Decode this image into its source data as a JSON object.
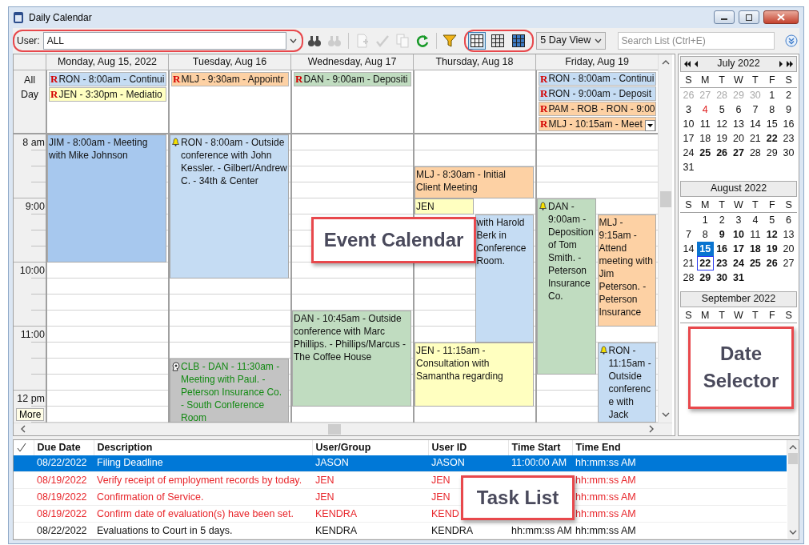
{
  "window": {
    "title": "Daily Calendar"
  },
  "toolbar": {
    "user_label": "User:",
    "user_value": "ALL",
    "user_highlighted": true,
    "tool_groups": [
      [
        {
          "kind": "find",
          "disabled": false
        },
        {
          "kind": "find_all",
          "disabled": true
        }
      ],
      [
        {
          "kind": "note",
          "disabled": true
        },
        {
          "kind": "check",
          "disabled": true
        },
        {
          "kind": "copy",
          "disabled": true
        },
        {
          "kind": "refresh",
          "disabled": false
        }
      ],
      [
        {
          "kind": "filter",
          "disabled": false
        }
      ]
    ],
    "views": [
      {
        "selected": true
      },
      {
        "selected": false
      },
      {
        "selected": false
      }
    ],
    "views_highlighted": true,
    "view_mode": "5 Day View",
    "search_placeholder": "Search List (Ctrl+E)"
  },
  "calendar": {
    "all_day_label": "All Day",
    "time_labels": [
      "8 am",
      "9:00",
      "10:00",
      "11:00",
      "12 pm"
    ],
    "more_label": "More",
    "callout": "Event Calendar",
    "days": [
      {
        "header": "Monday, Aug 15, 2022",
        "overflow": false,
        "all_day": [
          {
            "marker": "R",
            "text": "RON - 8:00am - Continui",
            "color": "#c5dcf3"
          },
          {
            "marker": "R",
            "text": "JEN - 3:30pm - Mediatio",
            "color": "#ffffc0"
          }
        ],
        "events": [
          {
            "text": "JIM - 8:00am - Meeting with Mike Johnson",
            "color": "#a7c8ee",
            "alarm": false,
            "shared": false
          }
        ]
      },
      {
        "header": "Tuesday, Aug 16",
        "overflow": false,
        "all_day": [
          {
            "marker": "R",
            "text": "MLJ - 9:30am - Appointr",
            "color": "#fdd1a4"
          }
        ],
        "events": [
          {
            "text": "RON - 8:00am - Outside conference with John Kessler. - Gilbert/Andrew C. - 34th & Center",
            "color": "#c5dcf3",
            "alarm": true,
            "shared": false
          },
          {
            "text": "CLB - DAN - 11:30am - Meeting with Paul. - Peterson Insurance Co. - South Conference Room",
            "color": "#c3c3c3",
            "alarm": false,
            "shared": true
          }
        ]
      },
      {
        "header": "Wednesday, Aug 17",
        "overflow": false,
        "all_day": [
          {
            "marker": "R",
            "text": "DAN - 9:00am - Depositi",
            "color": "#c0dcc0"
          }
        ],
        "events": [
          {
            "text": "DAN - 10:45am - Outside conference with Marc Phillips. - Phillips/Marcus - The Coffee House",
            "color": "#c0dcc0",
            "alarm": false,
            "shared": false
          }
        ]
      },
      {
        "header": "Thursday, Aug 18",
        "overflow": false,
        "events": [
          {
            "text": "MLJ - 8:30am - Initial Client Meeting",
            "color": "#fdd1a4",
            "alarm": false,
            "shared": false
          },
          {
            "text": "JEN",
            "color": "#ffffc0",
            "alarm": false,
            "shared": false
          },
          {
            "text": "with Harold Berk in Conference Room.",
            "color": "#c5dcf3",
            "alarm": false,
            "shared": false
          },
          {
            "text": "JEN - 11:15am - Consultation with Samantha regarding",
            "color": "#ffffc0",
            "alarm": false,
            "shared": false
          }
        ]
      },
      {
        "header": "Friday, Aug 19",
        "overflow": true,
        "all_day": [
          {
            "marker": "R",
            "text": "RON - 8:00am - Continui",
            "color": "#c5dcf3"
          },
          {
            "marker": "R",
            "text": "RON - 9:00am - Deposit",
            "color": "#c5dcf3"
          },
          {
            "marker": "R",
            "text": "PAM - ROB - RON - 9:00",
            "color": "#fdd1a4"
          },
          {
            "marker": "R",
            "text": "MLJ - 10:15am - Meet",
            "color": "#fdd1a4"
          }
        ],
        "events": [
          {
            "text": "DAN - 9:00am - Deposition of Tom Smith. - Peterson Insurance Co.",
            "color": "#c0dcc0",
            "alarm": true,
            "shared": false
          },
          {
            "text": "MLJ - 9:15am - Attend meeting with Jim Peterson. - Peterson Insurance",
            "color": "#fdd1a4",
            "alarm": false,
            "shared": false
          },
          {
            "text": "RON - 11:15am - Outside conference with Jack",
            "color": "#c5dcf3",
            "alarm": true,
            "shared": false
          }
        ]
      }
    ]
  },
  "date_selector": {
    "callout": "Date Selector",
    "months": [
      {
        "title": "July 2022",
        "navigation": true,
        "weekdays": [
          "S",
          "M",
          "T",
          "W",
          "T",
          "F",
          "S"
        ],
        "weeks": [
          [
            {
              "d": "26",
              "kind": "other",
              "selected": false,
              "today": false
            },
            {
              "d": "27",
              "kind": "other",
              "selected": false,
              "today": false
            },
            {
              "d": "28",
              "kind": "other",
              "selected": false,
              "today": false
            },
            {
              "d": "29",
              "kind": "other",
              "selected": false,
              "today": false
            },
            {
              "d": "30",
              "kind": "other",
              "selected": false,
              "today": false
            },
            {
              "d": "1",
              "kind": "plain",
              "selected": false,
              "today": false
            },
            {
              "d": "2",
              "kind": "plain",
              "selected": false,
              "today": false
            }
          ],
          [
            {
              "d": "3",
              "kind": "plain",
              "selected": false,
              "today": false
            },
            {
              "d": "4",
              "kind": "holiday",
              "selected": false,
              "today": false
            },
            {
              "d": "5",
              "kind": "plain",
              "selected": false,
              "today": false
            },
            {
              "d": "6",
              "kind": "plain",
              "selected": false,
              "today": false
            },
            {
              "d": "7",
              "kind": "plain",
              "selected": false,
              "today": false
            },
            {
              "d": "8",
              "kind": "plain",
              "selected": false,
              "today": false
            },
            {
              "d": "9",
              "kind": "plain",
              "selected": false,
              "today": false
            }
          ],
          [
            {
              "d": "10",
              "kind": "plain",
              "selected": false,
              "today": false
            },
            {
              "d": "11",
              "kind": "plain",
              "selected": false,
              "today": false
            },
            {
              "d": "12",
              "kind": "plain",
              "selected": false,
              "today": false
            },
            {
              "d": "13",
              "kind": "plain",
              "selected": false,
              "today": false
            },
            {
              "d": "14",
              "kind": "plain",
              "selected": false,
              "today": false
            },
            {
              "d": "15",
              "kind": "plain",
              "selected": false,
              "today": false
            },
            {
              "d": "16",
              "kind": "plain",
              "selected": false,
              "today": false
            }
          ],
          [
            {
              "d": "17",
              "kind": "plain",
              "selected": false,
              "today": false
            },
            {
              "d": "18",
              "kind": "plain",
              "selected": false,
              "today": false
            },
            {
              "d": "19",
              "kind": "plain",
              "selected": false,
              "today": false
            },
            {
              "d": "20",
              "kind": "plain",
              "selected": false,
              "today": false
            },
            {
              "d": "21",
              "kind": "plain",
              "selected": false,
              "today": false
            },
            {
              "d": "22",
              "kind": "busy",
              "selected": false,
              "today": false
            },
            {
              "d": "23",
              "kind": "plain",
              "selected": false,
              "today": false
            }
          ],
          [
            {
              "d": "24",
              "kind": "plain",
              "selected": false,
              "today": false
            },
            {
              "d": "25",
              "kind": "busy",
              "selected": false,
              "today": false
            },
            {
              "d": "26",
              "kind": "busy",
              "selected": false,
              "today": false
            },
            {
              "d": "27",
              "kind": "busy",
              "selected": false,
              "today": false
            },
            {
              "d": "28",
              "kind": "plain",
              "selected": false,
              "today": false
            },
            {
              "d": "29",
              "kind": "plain",
              "selected": false,
              "today": false
            },
            {
              "d": "30",
              "kind": "plain",
              "selected": false,
              "today": false
            }
          ],
          [
            {
              "d": "31",
              "kind": "plain",
              "selected": false,
              "today": false
            }
          ]
        ]
      },
      {
        "title": "August 2022",
        "navigation": false,
        "weekdays": [
          "S",
          "M",
          "T",
          "W",
          "T",
          "F",
          "S"
        ],
        "weeks": [
          [
            {
              "d": "1",
              "kind": "plain",
              "selected": false,
              "today": false
            },
            {
              "d": "2",
              "kind": "plain",
              "selected": false,
              "today": false
            },
            {
              "d": "3",
              "kind": "plain",
              "selected": false,
              "today": false
            },
            {
              "d": "4",
              "kind": "plain",
              "selected": false,
              "today": false
            },
            {
              "d": "5",
              "kind": "plain",
              "selected": false,
              "today": false
            },
            {
              "d": "6",
              "kind": "plain",
              "selected": false,
              "today": false
            }
          ],
          [
            {
              "d": "7",
              "kind": "plain",
              "selected": false,
              "today": false
            },
            {
              "d": "8",
              "kind": "plain",
              "selected": false,
              "today": false
            },
            {
              "d": "9",
              "kind": "busy",
              "selected": false,
              "today": false
            },
            {
              "d": "10",
              "kind": "busy",
              "selected": false,
              "today": false
            },
            {
              "d": "11",
              "kind": "plain",
              "selected": false,
              "today": false
            },
            {
              "d": "12",
              "kind": "busy",
              "selected": false,
              "today": false
            },
            {
              "d": "13",
              "kind": "plain",
              "selected": false,
              "today": false
            }
          ],
          [
            {
              "d": "14",
              "kind": "plain",
              "selected": false,
              "today": false
            },
            {
              "d": "15",
              "kind": "busy",
              "selected": true,
              "today": false
            },
            {
              "d": "16",
              "kind": "busy",
              "selected": false,
              "today": false
            },
            {
              "d": "17",
              "kind": "busy",
              "selected": false,
              "today": false
            },
            {
              "d": "18",
              "kind": "busy",
              "selected": false,
              "today": false
            },
            {
              "d": "19",
              "kind": "busy",
              "selected": false,
              "today": false
            },
            {
              "d": "20",
              "kind": "plain",
              "selected": false,
              "today": false
            }
          ],
          [
            {
              "d": "21",
              "kind": "plain",
              "selected": false,
              "today": false
            },
            {
              "d": "22",
              "kind": "busy",
              "selected": false,
              "today": true
            },
            {
              "d": "23",
              "kind": "busy",
              "selected": false,
              "today": false
            },
            {
              "d": "24",
              "kind": "busy",
              "selected": false,
              "today": false
            },
            {
              "d": "25",
              "kind": "busy",
              "selected": false,
              "today": false
            },
            {
              "d": "26",
              "kind": "busy",
              "selected": false,
              "today": false
            },
            {
              "d": "27",
              "kind": "plain",
              "selected": false,
              "today": false
            }
          ],
          [
            {
              "d": "28",
              "kind": "plain",
              "selected": false,
              "today": false
            },
            {
              "d": "29",
              "kind": "busy",
              "selected": false,
              "today": false
            },
            {
              "d": "30",
              "kind": "busy",
              "selected": false,
              "today": false
            },
            {
              "d": "31",
              "kind": "busy",
              "selected": false,
              "today": false
            }
          ]
        ]
      },
      {
        "title": "September 2022",
        "navigation": false,
        "weekdays": [
          "S",
          "M",
          "T",
          "W",
          "T",
          "F",
          "S"
        ]
      }
    ]
  },
  "task_list": {
    "callout": "Task List",
    "columns": [
      "Due Date",
      "Description",
      "User/Group",
      "User ID",
      "Time Start",
      "Time End"
    ],
    "rows": [
      {
        "due": "08/22/2022",
        "description": "Filing Deadline",
        "user_group": "JASON",
        "user_id": "JASON",
        "time_start": "11:00:00 AM",
        "time_end": "hh:mm:ss AM",
        "selected": true,
        "overdue": false
      },
      {
        "due": "08/19/2022",
        "description": "Verify receipt of employment records by today.",
        "user_group": "JEN",
        "user_id": "JEN",
        "time_end": "hh:mm:ss AM",
        "selected": false,
        "overdue": true
      },
      {
        "due": "08/19/2022",
        "description": "Confirmation of Service.",
        "user_group": "JEN",
        "user_id": "JEN",
        "time_end": "hh:mm:ss AM",
        "selected": false,
        "overdue": true
      },
      {
        "due": "08/19/2022",
        "description": "Confirm date of evaluation(s) have been set.",
        "user_group": "KENDRA",
        "user_id": "KEND",
        "time_end": "hh:mm:ss AM",
        "selected": false,
        "overdue": true
      },
      {
        "due": "08/22/2022",
        "description": "Evaluations to Court in 5 days.",
        "user_group": "KENDRA",
        "user_id": "KENDRA",
        "time_start": "hh:mm:ss AM",
        "time_end": "hh:mm:ss AM",
        "selected": false,
        "overdue": false
      }
    ]
  }
}
